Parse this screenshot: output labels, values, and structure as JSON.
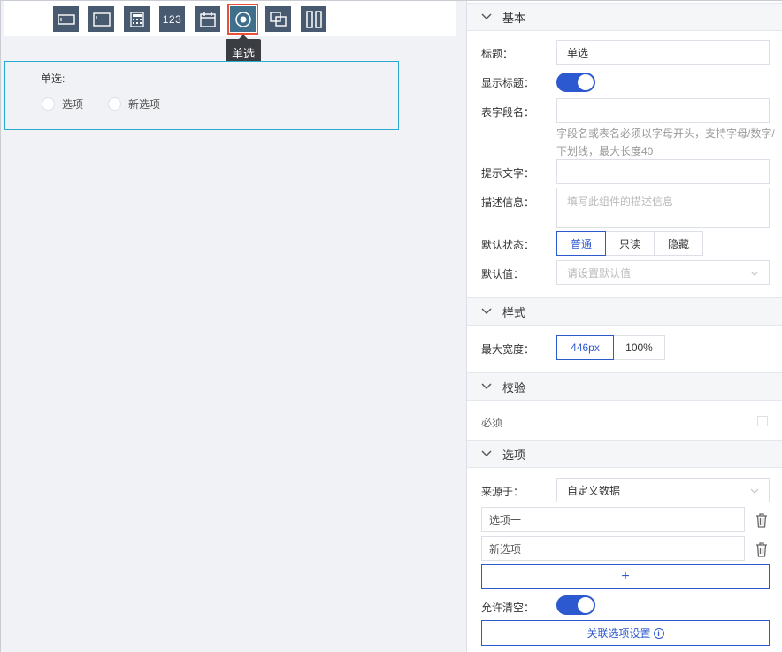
{
  "toolbar": {
    "tools": [
      {
        "icon": "single-line-input-icon"
      },
      {
        "icon": "multi-line-input-icon"
      },
      {
        "icon": "calculator-icon"
      },
      {
        "icon": "number-icon",
        "label": "123"
      },
      {
        "icon": "calendar-icon"
      },
      {
        "icon": "radio-icon"
      },
      {
        "icon": "multi-select-icon"
      },
      {
        "icon": "column-layout-icon"
      }
    ],
    "tooltip": "单选"
  },
  "canvas": {
    "field_label": "单选:",
    "options": [
      "选项一",
      "新选项"
    ]
  },
  "panel": {
    "basic": {
      "title": "基本",
      "title_label": "标题：",
      "title_value": "单选",
      "show_title_label": "显示标题：",
      "field_name_label": "表字段名：",
      "field_name_value": "",
      "field_name_hint": "字段名或表名必须以字母开头，支持字母/数字/下划线，最大长度40",
      "prompt_label": "提示文字：",
      "prompt_value": "",
      "desc_label": "描述信息：",
      "desc_placeholder": "填写此组件的描述信息",
      "default_state_label": "默认状态：",
      "states": [
        "普通",
        "只读",
        "隐藏"
      ],
      "default_value_label": "默认值：",
      "default_value_placeholder": "请设置默认值"
    },
    "style": {
      "title": "样式",
      "max_width_label": "最大宽度：",
      "widths": [
        "446px",
        "100%"
      ]
    },
    "validation": {
      "title": "校验",
      "required_label": "必须"
    },
    "options": {
      "title": "选项",
      "source_label": "来源于：",
      "source_value": "自定义数据",
      "items": [
        "选项一",
        "新选项"
      ],
      "add_label": "+",
      "allow_clear_label": "允许清空：",
      "link_label": "关联选项设置"
    }
  }
}
